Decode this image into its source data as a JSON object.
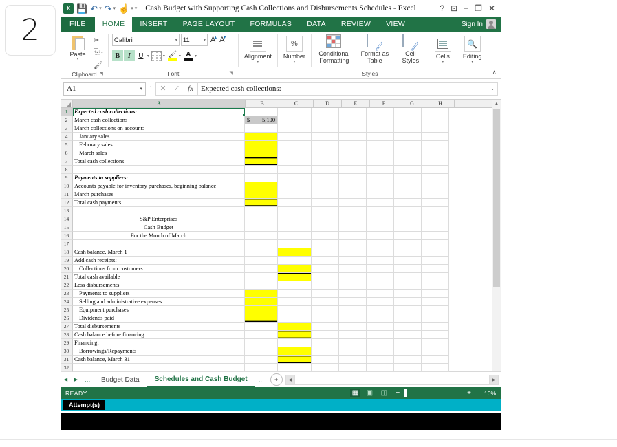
{
  "attempt_badge": "2",
  "window": {
    "title": "Cash Budget with Supporting Cash Collections and Disbursements Schedules - Excel",
    "help": "?",
    "ribbon_display": "⬜",
    "minimize": "–",
    "restore": "❐",
    "close": "✕"
  },
  "quick_access": {
    "save": "💾",
    "undo": "↶",
    "redo": "↷",
    "touch": "☝",
    "customize": "≡"
  },
  "tabs": {
    "file": "FILE",
    "items": [
      "HOME",
      "INSERT",
      "PAGE LAYOUT",
      "FORMULAS",
      "DATA",
      "REVIEW",
      "VIEW"
    ],
    "active": "HOME",
    "sign_in": "Sign In"
  },
  "ribbon": {
    "clipboard": {
      "label": "Clipboard",
      "paste": "Paste",
      "cut": "✂",
      "copy": "⎘",
      "format_painter": "🖌"
    },
    "font": {
      "label": "Font",
      "font_name": "Calibri",
      "font_size": "11",
      "grow": "A",
      "shrink": "A",
      "bold": "B",
      "italic": "I",
      "underline": "U",
      "borders": "⊞",
      "fill_color": "🖌",
      "font_color": "A"
    },
    "alignment": {
      "label": "Alignment"
    },
    "number": {
      "label": "Number",
      "glyph": "%"
    },
    "styles": {
      "label": "Styles",
      "conditional_formatting": "Conditional Formatting",
      "format_as_table": "Format as Table",
      "cell_styles": "Cell Styles"
    },
    "cells": {
      "label": "Cells"
    },
    "editing": {
      "label": "Editing",
      "glyph": "🔍"
    },
    "collapse": "∧"
  },
  "formula_bar": {
    "name_box": "A1",
    "cancel": "✕",
    "enter": "✓",
    "insert_function": "fx",
    "content": "Expected cash collections:",
    "expand": "⌄"
  },
  "grid": {
    "columns": [
      "A",
      "B",
      "C",
      "D",
      "E",
      "F",
      "G",
      "H"
    ],
    "selected_column": "A",
    "selected_cell": "A1",
    "rows": [
      {
        "n": "1",
        "a": "Expected cash collections:",
        "style": "header",
        "b": "",
        "c": ""
      },
      {
        "n": "2",
        "a": "March cash collections",
        "b": "$          5,100",
        "b_fill": "gray",
        "c": ""
      },
      {
        "n": "3",
        "a": "March collections on account:",
        "b": "",
        "c": ""
      },
      {
        "n": "4",
        "a": "January sales",
        "indent": 1,
        "b": "",
        "b_fill": "yellow",
        "c": ""
      },
      {
        "n": "5",
        "a": "February sales",
        "indent": 1,
        "b": "",
        "b_fill": "yellow",
        "c": ""
      },
      {
        "n": "6",
        "a": "March sales",
        "indent": 1,
        "b": "",
        "b_fill": "yellow",
        "c": ""
      },
      {
        "n": "7",
        "a": "Total cash collections",
        "b": "",
        "b_fill": "yellow",
        "b_border": "top-double-bottom",
        "c": ""
      },
      {
        "n": "8",
        "a": "",
        "b": "",
        "c": ""
      },
      {
        "n": "9",
        "a": "Payments to suppliers:",
        "style": "header",
        "b": "",
        "c": ""
      },
      {
        "n": "10",
        "a": "Accounts payable for inventory purchases, beginning balance",
        "b": "",
        "b_fill": "yellow",
        "c": ""
      },
      {
        "n": "11",
        "a": "March purchases",
        "b": "",
        "b_fill": "yellow",
        "c": ""
      },
      {
        "n": "12",
        "a": "Total cash payments",
        "b": "",
        "b_fill": "yellow",
        "b_border": "top-double-bottom",
        "c": ""
      },
      {
        "n": "13",
        "a": "",
        "b": "",
        "c": ""
      },
      {
        "n": "14",
        "a": "S&P Enterprises",
        "align": "center",
        "b": "",
        "c": ""
      },
      {
        "n": "15",
        "a": "Cash Budget",
        "align": "center",
        "b": "",
        "c": ""
      },
      {
        "n": "16",
        "a": "For the Month of March",
        "align": "center",
        "b": "",
        "c": ""
      },
      {
        "n": "17",
        "a": "",
        "b": "",
        "c": ""
      },
      {
        "n": "18",
        "a": "Cash balance, March 1",
        "b": "",
        "c": "",
        "c_fill": "yellow"
      },
      {
        "n": "19",
        "a": "Add cash receipts:",
        "b": "",
        "c": ""
      },
      {
        "n": "20",
        "a": "Collections from customers",
        "indent": 1,
        "b": "",
        "c": "",
        "c_fill": "yellow"
      },
      {
        "n": "21",
        "a": "Total cash available",
        "b": "",
        "c": "",
        "c_fill": "yellow",
        "c_border": "top"
      },
      {
        "n": "22",
        "a": "Less disbursements:",
        "b": "",
        "c": ""
      },
      {
        "n": "23",
        "a": "Payments to suppliers",
        "indent": 1,
        "b": "",
        "b_fill": "yellow",
        "c": ""
      },
      {
        "n": "24",
        "a": "Selling and administrative expenses",
        "indent": 1,
        "b": "",
        "b_fill": "yellow",
        "c": ""
      },
      {
        "n": "25",
        "a": "Equipment purchases",
        "indent": 1,
        "b": "",
        "b_fill": "yellow",
        "c": ""
      },
      {
        "n": "26",
        "a": "Dividends paid",
        "indent": 1,
        "b": "",
        "b_fill": "yellow",
        "b_border": "bottom",
        "c": ""
      },
      {
        "n": "27",
        "a": "Total disbursements",
        "b": "",
        "c": "",
        "c_fill": "yellow"
      },
      {
        "n": "28",
        "a": "Cash balance before financing",
        "b": "",
        "c": "",
        "c_fill": "yellow",
        "c_border": "top-bottom"
      },
      {
        "n": "29",
        "a": "Financing:",
        "b": "",
        "c": ""
      },
      {
        "n": "30",
        "a": "Borrowings/Repayments",
        "indent": 1,
        "b": "",
        "c": "",
        "c_fill": "yellow"
      },
      {
        "n": "31",
        "a": "Cash balance, March 31",
        "b": "",
        "c": "",
        "c_fill": "yellow",
        "c_border": "top-double-bottom"
      },
      {
        "n": "32",
        "a": "",
        "b": "",
        "c": ""
      }
    ]
  },
  "sheet_tabs": {
    "first": "◀",
    "prev": "◀",
    "next": "▶",
    "last": "▶",
    "ellipsis_left": "…",
    "ellipsis_right": "…",
    "items": [
      "Budget Data",
      "Schedules and Cash Budget"
    ],
    "active": "Schedules and Cash Budget",
    "add": "+"
  },
  "status_bar": {
    "state": "READY",
    "view_normal": "▦",
    "view_layout": "▣",
    "view_preview": "◫",
    "zoom_out": "−",
    "zoom_in": "+",
    "zoom_level": "10%"
  },
  "attempts_bar": {
    "label": "Attempt(s)"
  },
  "colors": {
    "excel_green": "#217346",
    "highlight_yellow": "#ffff00",
    "gray_fill": "#c9c9c9",
    "cyan_bar": "#00b0c7"
  }
}
